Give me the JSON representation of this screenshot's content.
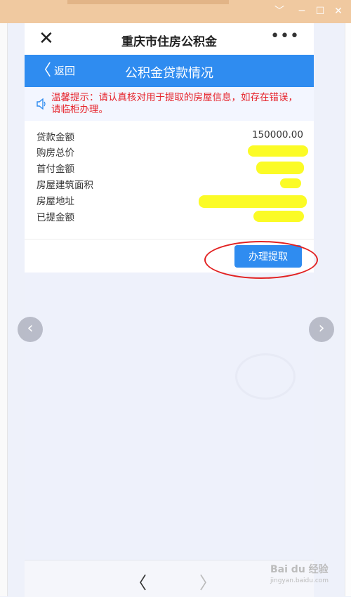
{
  "window": {
    "minimize_glyph": "﹀",
    "restore_glyph": "─",
    "maximize_glyph": "☐",
    "close_glyph": "✕"
  },
  "app_header": {
    "title": "重庆市住房公积金",
    "close_glyph": "✕",
    "more_glyph": "•••"
  },
  "nav": {
    "back_label": "返回",
    "back_glyph": "〈",
    "title": "公积金贷款情况"
  },
  "notice": {
    "text": "温馨提示：请认真核对用于提取的房屋信息，如存在错误，请临柜办理。"
  },
  "loan_info": [
    {
      "label": "贷款金额",
      "value": "150000.00"
    },
    {
      "label": "购房总价",
      "value": ""
    },
    {
      "label": "首付金额",
      "value": ""
    },
    {
      "label": "房屋建筑面积",
      "value": ""
    },
    {
      "label": "房屋地址",
      "value": ""
    },
    {
      "label": "已提金额",
      "value": ""
    }
  ],
  "actions": {
    "withdraw_label": "办理提取"
  },
  "pager": {
    "prev_glyph": "〈",
    "next_glyph": "〉"
  },
  "slide_nav": {
    "left_glyph": "‹",
    "right_glyph": "›"
  },
  "watermark": {
    "brand": "Bai du 经验",
    "url": "jingyan.baidu.com"
  },
  "colors": {
    "primary_blue": "#2f8cf0",
    "notice_red": "#e6232b",
    "highlight_circle": "#e22222",
    "redaction_yellow": "#fbfb1a"
  }
}
